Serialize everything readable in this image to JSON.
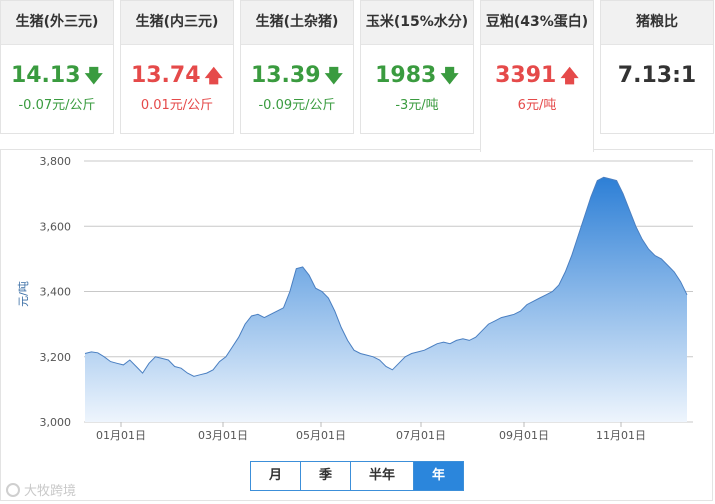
{
  "cards": [
    {
      "title": "生猪(外三元)",
      "value": "14.13",
      "arrow": "down",
      "change": "-0.07元/公斤",
      "trend": "down"
    },
    {
      "title": "生猪(内三元)",
      "value": "13.74",
      "arrow": "up",
      "change": "0.01元/公斤",
      "trend": "up"
    },
    {
      "title": "生猪(土杂猪)",
      "value": "13.39",
      "arrow": "down",
      "change": "-0.09元/公斤",
      "trend": "down"
    },
    {
      "title": "玉米(15%水分)",
      "value": "1983",
      "arrow": "down",
      "change": "-3元/吨",
      "trend": "down"
    },
    {
      "title": "豆粕(43%蛋白)",
      "value": "3391",
      "arrow": "up",
      "change": "6元/吨",
      "trend": "up"
    },
    {
      "title": "猪粮比",
      "value": "7.13:1",
      "arrow": "",
      "change": "",
      "trend": "neutral"
    }
  ],
  "range_tabs": [
    "月",
    "季",
    "半年",
    "年"
  ],
  "active_tab": "年",
  "watermark": "大牧跨境",
  "colors": {
    "up": "#e54a4a",
    "down": "#3a9b3f",
    "accent": "#2b86dc",
    "area_top": "#2d7fd6",
    "area_bottom": "#eef5fd"
  },
  "chart_data": {
    "type": "area",
    "title": "",
    "xlabel": "",
    "ylabel": "元/吨",
    "ylim": [
      3000,
      3800
    ],
    "yticks": [
      3000,
      3200,
      3400,
      3600,
      3800
    ],
    "ytick_labels": [
      "3,000",
      "3,200",
      "3,400",
      "3,600",
      "3,800"
    ],
    "xtick_labels": [
      "01月01日",
      "03月01日",
      "05月01日",
      "07月01日",
      "09月01日",
      "11月01日"
    ],
    "grid": true,
    "legend": "none",
    "series": [
      {
        "values": [
          3210,
          3215,
          3212,
          3200,
          3185,
          3180,
          3175,
          3190,
          3170,
          3150,
          3180,
          3200,
          3195,
          3190,
          3170,
          3165,
          3150,
          3140,
          3145,
          3150,
          3160,
          3185,
          3200,
          3230,
          3260,
          3300,
          3325,
          3330,
          3320,
          3330,
          3340,
          3350,
          3400,
          3470,
          3475,
          3450,
          3410,
          3400,
          3380,
          3340,
          3290,
          3250,
          3220,
          3210,
          3205,
          3200,
          3190,
          3170,
          3160,
          3180,
          3200,
          3210,
          3215,
          3220,
          3230,
          3240,
          3245,
          3240,
          3250,
          3255,
          3250,
          3260,
          3280,
          3300,
          3310,
          3320,
          3325,
          3330,
          3340,
          3360,
          3370,
          3380,
          3390,
          3400,
          3420,
          3460,
          3510,
          3570,
          3630,
          3690,
          3740,
          3750,
          3745,
          3740,
          3700,
          3650,
          3600,
          3560,
          3530,
          3510,
          3500,
          3480,
          3460,
          3430,
          3390
        ]
      }
    ]
  }
}
